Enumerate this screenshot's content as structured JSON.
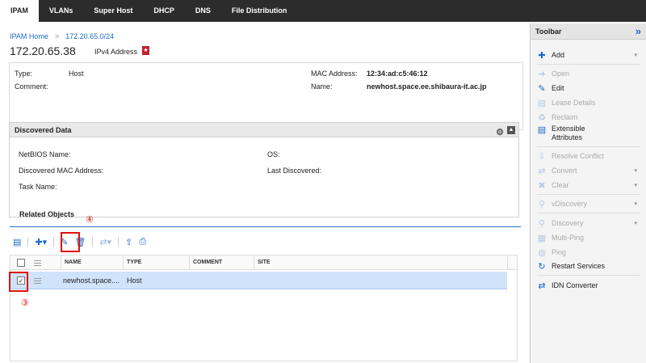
{
  "nav": {
    "tabs": [
      {
        "label": "IPAM"
      },
      {
        "label": "VLANs"
      },
      {
        "label": "Super Host"
      },
      {
        "label": "DHCP"
      },
      {
        "label": "DNS"
      },
      {
        "label": "File Distribution"
      }
    ]
  },
  "breadcrumb": {
    "home": "IPAM Home",
    "sep": ">",
    "current": "172.20.65.0/24"
  },
  "header": {
    "ip": "172.20.65.38",
    "type": "IPv4 Address"
  },
  "details": {
    "type_label": "Type:",
    "type_value": "Host",
    "comment_label": "Comment:",
    "mac_label": "MAC Address:",
    "mac_value": "12:34:ad:c5:46:12",
    "name_label": "Name:",
    "name_value": "newhost.space.ee.shibaura-it.ac.jp"
  },
  "discovered": {
    "title": "Discovered Data",
    "netbios": "NetBIOS Name:",
    "os": "OS:",
    "mac": "Discovered MAC Address:",
    "last": "Last Discovered:",
    "task": "Task Name:"
  },
  "related": {
    "title": "Related Objects",
    "callout_top": "④",
    "callout_bottom": "③",
    "columns": [
      "NAME",
      "TYPE",
      "COMMENT",
      "SITE"
    ],
    "rows": [
      {
        "name": "newhost.space....",
        "type": "Host",
        "checked": "✓"
      }
    ]
  },
  "toolbar": {
    "title": "Toolbar",
    "collapse": "»",
    "items": [
      {
        "label": "Add",
        "icon": "plus-icon"
      },
      {
        "label": "Open",
        "icon": "arrow-right-icon"
      },
      {
        "label": "Edit",
        "icon": "edit-icon"
      },
      {
        "label": "Lease Details",
        "icon": "list-icon"
      },
      {
        "label": "Reclaim",
        "icon": "recycle-icon"
      },
      {
        "label": "Extensible Attributes",
        "icon": "list-icon"
      },
      {
        "label": "Resolve Conflict",
        "icon": "resolve-icon"
      },
      {
        "label": "Convert",
        "icon": "convert-icon"
      },
      {
        "label": "Clear",
        "icon": "clear-icon"
      },
      {
        "label": "vDiscovery",
        "icon": "search-icon"
      },
      {
        "label": "Discovery",
        "icon": "search-icon"
      },
      {
        "label": "Multi-Ping",
        "icon": "multiping-icon"
      },
      {
        "label": "Ping",
        "icon": "ping-icon"
      },
      {
        "label": "Restart Services",
        "icon": "restart-icon"
      },
      {
        "label": "IDN Converter",
        "icon": "convert-icon"
      }
    ]
  },
  "colors": {
    "nav_bg": "#2c2c2c",
    "link": "#1b6ac9",
    "highlight": "#cfe3fb",
    "callout": "#e01010"
  }
}
